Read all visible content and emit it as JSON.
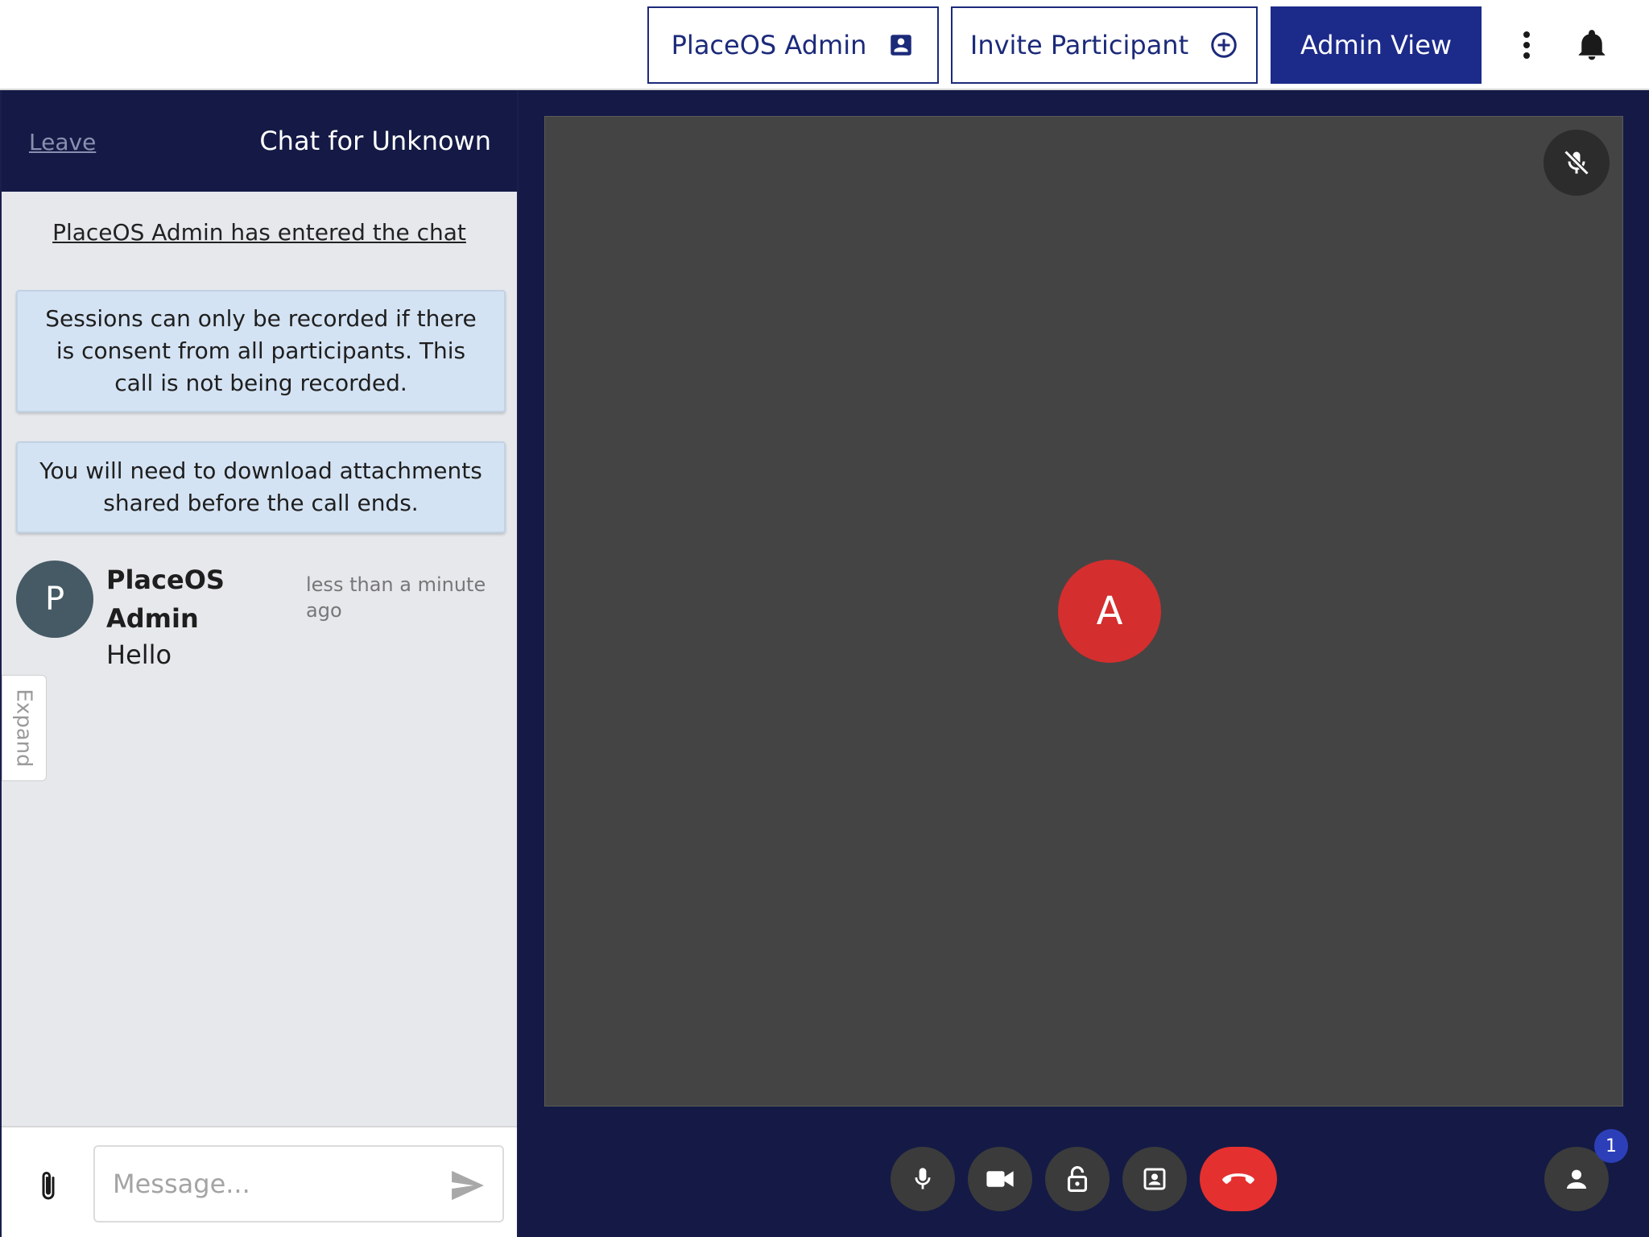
{
  "header": {
    "user_button_label": "PlaceOS Admin",
    "user_button_icon": "account-box-icon",
    "invite_button_label": "Invite Participant",
    "invite_button_icon": "add-circle-icon",
    "admin_view_label": "Admin View",
    "more_icon": "more-vert-icon",
    "notifications_icon": "bell-icon"
  },
  "chat": {
    "leave_label": "Leave",
    "title": "Chat for Unknown",
    "entered_text": "PlaceOS Admin has entered the chat",
    "notices": [
      "Sessions can only be recorded if there is consent from all participants. This call is not being recorded.",
      "You will need to download attachments shared before the call ends."
    ],
    "messages": [
      {
        "avatar_initial": "P",
        "sender": "PlaceOS Admin",
        "time": "less than a minute ago",
        "text": "Hello"
      }
    ],
    "expand_label": "Expand",
    "composer": {
      "placeholder": "Message...",
      "attach_icon": "paperclip-icon",
      "send_icon": "send-icon"
    }
  },
  "video": {
    "participant_initial": "A",
    "participant_muted": true,
    "participant_count": "1"
  },
  "colors": {
    "navy": "#141a45",
    "accent_blue": "#1c2a8a",
    "end_call_red": "#e53030",
    "avatar_red": "#d42e2e",
    "avatar_grey": "#455a64",
    "notice_bg": "#d4e3f3"
  }
}
